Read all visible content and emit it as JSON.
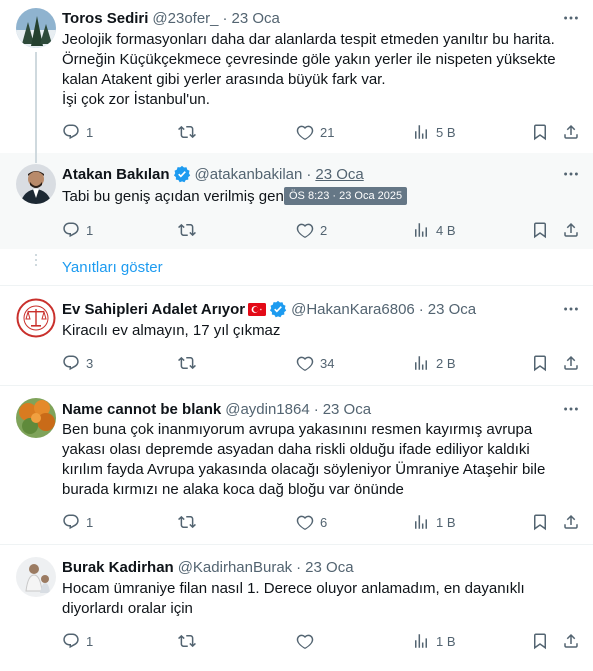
{
  "tweets": [
    {
      "name": "Toros Sediri",
      "handle": "@23ofer_",
      "time": "23 Oca",
      "lines": [
        "Jeolojik formasyonları daha dar alanlarda tespit etmeden yanıltır bu harita.",
        "Örneğin Küçükçekmece çevresinde göle yakın yerler ile nispeten yüksekte",
        "kalan Atakent gibi yerler arasında büyük fark var.",
        "İşi çok zor İstanbul'un."
      ],
      "replies": "1",
      "likes": "21",
      "views": "5 B"
    },
    {
      "name": "Atakan Bakılan",
      "handle": "@atakanbakilan",
      "time": "23 Oca",
      "lines": [
        "Tabi bu geniş açıdan verilmiş genel bir harita"
      ],
      "replies": "1",
      "likes": "2",
      "views": "4 B",
      "tooltip": "ÖS 8:23 · 23 Oca 2025"
    },
    {
      "name": "Ev Sahipleri Adalet Arıyor",
      "handle": "@HakanKara6806",
      "time": "23 Oca",
      "lines": [
        "Kiracılı ev almayın, 17 yıl çıkmaz"
      ],
      "replies": "3",
      "likes": "34",
      "views": "2 B"
    },
    {
      "name": "Name cannot be blank",
      "handle": "@aydin1864",
      "time": "23 Oca",
      "lines": [
        "Ben buna çok inanmıyorum avrupa yakasınını resmen kayırmış avrupa",
        "yakası olası depremde asyadan daha riskli olduğu ifade ediliyor kaldıki",
        "kırılım fayda Avrupa yakasında olacağı söyleniyor Ümraniye Ataşehir bile",
        "burada kırmızı ne alaka koca dağ bloğu var önünde"
      ],
      "replies": "1",
      "likes": "6",
      "views": "1 B"
    },
    {
      "name": "Burak Kadirhan",
      "handle": "@KadirhanBurak",
      "time": "23 Oca",
      "lines": [
        "Hocam ümraniye filan nasıl 1. Derece oluyor anlamadım, en dayanıklı",
        "diyorlardı oralar için"
      ],
      "replies": "1",
      "likes": "",
      "views": "1 B"
    }
  ],
  "show_replies": "Yanıtları göster",
  "icons": {
    "reply": "reply-icon",
    "retweet": "retweet-icon",
    "like": "like-icon",
    "views": "views-icon",
    "bookmark": "bookmark-icon",
    "share": "share-icon",
    "more": "more-icon",
    "verified": "verified-badge-icon"
  },
  "colors": {
    "text": "#0f1419",
    "muted": "#536471",
    "link": "#1d9bf0",
    "highlight_bg": "#f7f9f9"
  }
}
